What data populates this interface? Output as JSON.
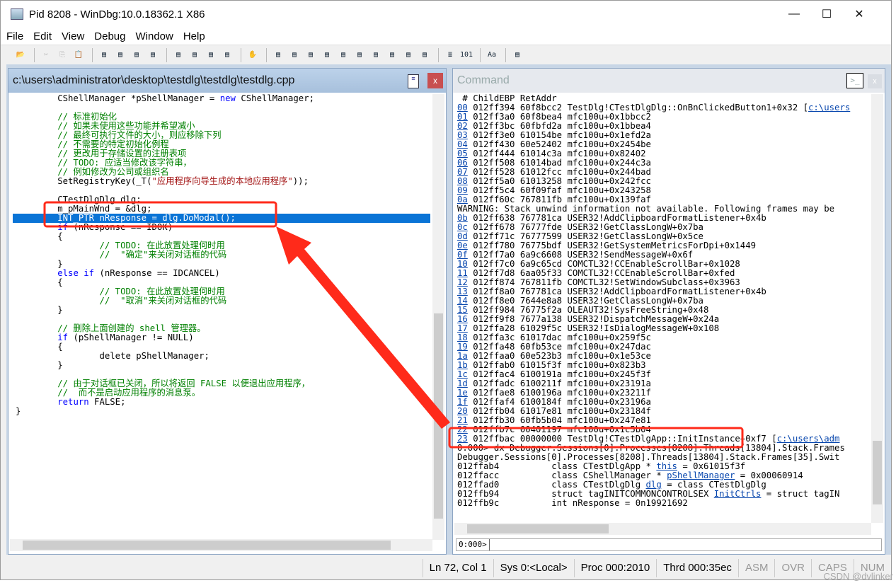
{
  "window": {
    "title": "Pid 8208 - WinDbg:10.0.18362.1 X86",
    "minimize": "—",
    "maximize": "☐",
    "close": "✕"
  },
  "menu": [
    "File",
    "Edit",
    "View",
    "Debug",
    "Window",
    "Help"
  ],
  "toolbar": [
    "open-icon",
    "cut-icon",
    "copy-icon",
    "paste-icon",
    "step-into-icon",
    "step-over-icon",
    "step-out-icon",
    "run-to-cursor-icon",
    "go-icon",
    "break-icon",
    "restart-icon",
    "stop-icon",
    "break-hand-icon",
    "command-window-icon",
    "watch-icon",
    "locals-icon",
    "registers-icon",
    "memory-icon",
    "call-stack-icon",
    "disassembly-icon",
    "scratch-pad-icon",
    "processes-icon",
    "command-browser-icon",
    "source-mode-icon",
    "hex-mode-icon",
    "font-icon",
    "options-icon"
  ],
  "source": {
    "path": "c:\\users\\administrator\\desktop\\testdlg\\testdlg\\testdlg.cpp",
    "close": "x",
    "lines": [
      [
        [
          "",
          "        CShellManager *pShellManager = "
        ],
        [
          "kw",
          "new"
        ],
        [
          "",
          " CShellManager;"
        ]
      ],
      [],
      [
        [
          "cm",
          "        // 标准初始化"
        ]
      ],
      [
        [
          "cm",
          "        // 如果未使用这些功能并希望减小"
        ]
      ],
      [
        [
          "cm",
          "        // 最终可执行文件的大小，则应移除下列"
        ]
      ],
      [
        [
          "cm",
          "        // 不需要的特定初始化例程"
        ]
      ],
      [
        [
          "cm",
          "        // 更改用于存储设置的注册表项"
        ]
      ],
      [
        [
          "cm",
          "        // TODO: 应适当修改该字符串，"
        ]
      ],
      [
        [
          "cm",
          "        // 例如修改为公司或组织名"
        ]
      ],
      [
        [
          "",
          "        SetRegistryKey(_T("
        ],
        [
          "st",
          "\"应用程序向导生成的本地应用程序\""
        ],
        [
          "",
          "));"
        ]
      ],
      [],
      [
        [
          "",
          "        CTestDlgDlg dlg;"
        ]
      ],
      [
        [
          "",
          "        m_pMainWnd = &dlg;"
        ]
      ],
      [
        [
          "",
          "        INT_PTR nResponse = dlg.DoModal();"
        ]
      ],
      [
        [
          "",
          "        "
        ],
        [
          "kw",
          "if"
        ],
        [
          "",
          " (nResponse == IDOK)"
        ]
      ],
      [
        [
          "",
          "        {"
        ]
      ],
      [
        [
          "cm",
          "                // TODO: 在此放置处理何时用"
        ]
      ],
      [
        [
          "cm",
          "                //  \"确定\"来关闭对话框的代码"
        ]
      ],
      [
        [
          "",
          "        }"
        ]
      ],
      [
        [
          "",
          "        "
        ],
        [
          "kw",
          "else if"
        ],
        [
          "",
          " (nResponse == IDCANCEL)"
        ]
      ],
      [
        [
          "",
          "        {"
        ]
      ],
      [
        [
          "cm",
          "                // TODO: 在此放置处理何时用"
        ]
      ],
      [
        [
          "cm",
          "                //  \"取消\"来关闭对话框的代码"
        ]
      ],
      [
        [
          "",
          "        }"
        ]
      ],
      [],
      [
        [
          "cm",
          "        // 删除上面创建的 shell 管理器。"
        ]
      ],
      [
        [
          "",
          "        "
        ],
        [
          "kw",
          "if"
        ],
        [
          "",
          " (pShellManager != NULL)"
        ]
      ],
      [
        [
          "",
          "        {"
        ]
      ],
      [
        [
          "",
          "                delete pShellManager;"
        ]
      ],
      [
        [
          "",
          "        }"
        ]
      ],
      [],
      [
        [
          "cm",
          "        // 由于对话框已关闭，所以将返回 FALSE 以便退出应用程序，"
        ]
      ],
      [
        [
          "cm",
          "        //  而不是启动应用程序的消息泵。"
        ]
      ],
      [
        [
          "",
          "        "
        ],
        [
          "kw",
          "return"
        ],
        [
          "",
          " FALSE;"
        ]
      ],
      [
        [
          "",
          "}"
        ]
      ]
    ]
  },
  "command": {
    "title": "Command",
    "header": " # ChildEBP RetAddr",
    "frames_a": [
      [
        "00",
        "012ff394",
        "60f8bcc2",
        "TestDlg!CTestDlgDlg::OnBnClickedButton1+0x32 [",
        "c:\\users"
      ],
      [
        "01",
        "012ff3a0",
        "60f8bea4",
        "mfc100u+0x1bbcc2"
      ],
      [
        "02",
        "012ff3bc",
        "60fbfd2a",
        "mfc100u+0x1bbea4"
      ],
      [
        "03",
        "012ff3e0",
        "610154be",
        "mfc100u+0x1efd2a"
      ],
      [
        "04",
        "012ff430",
        "60e52402",
        "mfc100u+0x2454be"
      ],
      [
        "05",
        "012ff444",
        "61014c3a",
        "mfc100u+0x82402"
      ],
      [
        "06",
        "012ff508",
        "61014bad",
        "mfc100u+0x244c3a"
      ],
      [
        "07",
        "012ff528",
        "61012fcc",
        "mfc100u+0x244bad"
      ],
      [
        "08",
        "012ff5a0",
        "61013258",
        "mfc100u+0x242fcc"
      ],
      [
        "09",
        "012ff5c4",
        "60f09faf",
        "mfc100u+0x243258"
      ],
      [
        "0a",
        "012ff60c",
        "767811fb",
        "mfc100u+0x139faf"
      ]
    ],
    "warning": "WARNING: Stack unwind information not available. Following frames may be",
    "frames_b": [
      [
        "0b",
        "012ff638",
        "767781ca",
        "USER32!AddClipboardFormatListener+0x4b"
      ],
      [
        "0c",
        "012ff678",
        "76777fde",
        "USER32!GetClassLongW+0x7ba"
      ],
      [
        "0d",
        "012ff71c",
        "76777599",
        "USER32!GetClassLongW+0x5ce"
      ],
      [
        "0e",
        "012ff780",
        "76775bdf",
        "USER32!GetSystemMetricsForDpi+0x1449"
      ],
      [
        "0f",
        "012ff7a0",
        "6a9c6608",
        "USER32!SendMessageW+0x6f"
      ],
      [
        "10",
        "012ff7c0",
        "6a9c65cd",
        "COMCTL32!CCEnableScrollBar+0x1028"
      ],
      [
        "11",
        "012ff7d8",
        "6aa05f33",
        "COMCTL32!CCEnableScrollBar+0xfed"
      ],
      [
        "12",
        "012ff874",
        "767811fb",
        "COMCTL32!SetWindowSubclass+0x3963"
      ],
      [
        "13",
        "012ff8a0",
        "767781ca",
        "USER32!AddClipboardFormatListener+0x4b"
      ],
      [
        "14",
        "012ff8e0",
        "7644e8a8",
        "USER32!GetClassLongW+0x7ba"
      ],
      [
        "15",
        "012ff984",
        "76775f2a",
        "OLEAUT32!SysFreeString+0x48"
      ],
      [
        "16",
        "012ff9f8",
        "7677a138",
        "USER32!DispatchMessageW+0x24a"
      ],
      [
        "17",
        "012ffa28",
        "61029f5c",
        "USER32!IsDialogMessageW+0x108"
      ],
      [
        "18",
        "012ffa3c",
        "61017dac",
        "mfc100u+0x259f5c"
      ],
      [
        "19",
        "012ffa48",
        "60fb53ce",
        "mfc100u+0x247dac"
      ],
      [
        "1a",
        "012ffaa0",
        "60e523b3",
        "mfc100u+0x1e53ce"
      ],
      [
        "1b",
        "012ffab0",
        "61015f3f",
        "mfc100u+0x823b3"
      ],
      [
        "1c",
        "012ffac4",
        "6100191a",
        "mfc100u+0x245f3f"
      ],
      [
        "1d",
        "012ffadc",
        "6100211f",
        "mfc100u+0x23191a"
      ],
      [
        "1e",
        "012ffae8",
        "6100196a",
        "mfc100u+0x23211f"
      ],
      [
        "1f",
        "012ffaf4",
        "6100184f",
        "mfc100u+0x23196a"
      ],
      [
        "20",
        "012ffb04",
        "61017e81",
        "mfc100u+0x23184f"
      ],
      [
        "21",
        "012ffb30",
        "60fb5b04",
        "mfc100u+0x247e81"
      ],
      [
        "22",
        "012ffb7c",
        "00401197",
        "mfc100u+0x1c5b04"
      ],
      [
        "23",
        "012ffbac",
        "00000000",
        "TestDlg!CTestDlgApp::InitInstance+0xf7 [",
        "c:\\users\\adm"
      ]
    ],
    "dx_cmd": "0:000> dx Debugger.Sessions[0].Processes[8208].Threads[13804].Stack.Frames",
    "dx_echo": "Debugger.Sessions[0].Processes[8208].Threads[13804].Stack.Frames[35].Swit",
    "locals": [
      [
        "012ffab4",
        "class CTestDlgApp * ",
        "this",
        " = 0x61015f3f"
      ],
      [
        "012ffacc",
        "class CShellManager * ",
        "pShellManager",
        " = 0x00060914"
      ],
      [
        "012ffad0",
        "class CTestDlgDlg ",
        "dlg",
        " = class CTestDlgDlg"
      ],
      [
        "012ffb94",
        "struct tagINITCOMMONCONTROLSEX ",
        "InitCtrls",
        " = struct tagIN"
      ],
      [
        "012ffb9c",
        "int nResponse = 0n19921692",
        "",
        ""
      ]
    ],
    "prompt": "0:000>",
    "input": ""
  },
  "status": {
    "position": "Ln 72, Col 1",
    "sys": "Sys 0:<Local>",
    "proc": "Proc 000:2010",
    "thrd": "Thrd 000:35ec",
    "asm": "ASM",
    "ovr": "OVR",
    "caps": "CAPS",
    "num": "NUM"
  },
  "watermark": "CSDN @dvlinker",
  "colors": {
    "highlight": "#0a74d6",
    "annotation": "#ff2a1a",
    "link": "#0645ad",
    "keyword": "#0000ff",
    "comment": "#008000"
  }
}
